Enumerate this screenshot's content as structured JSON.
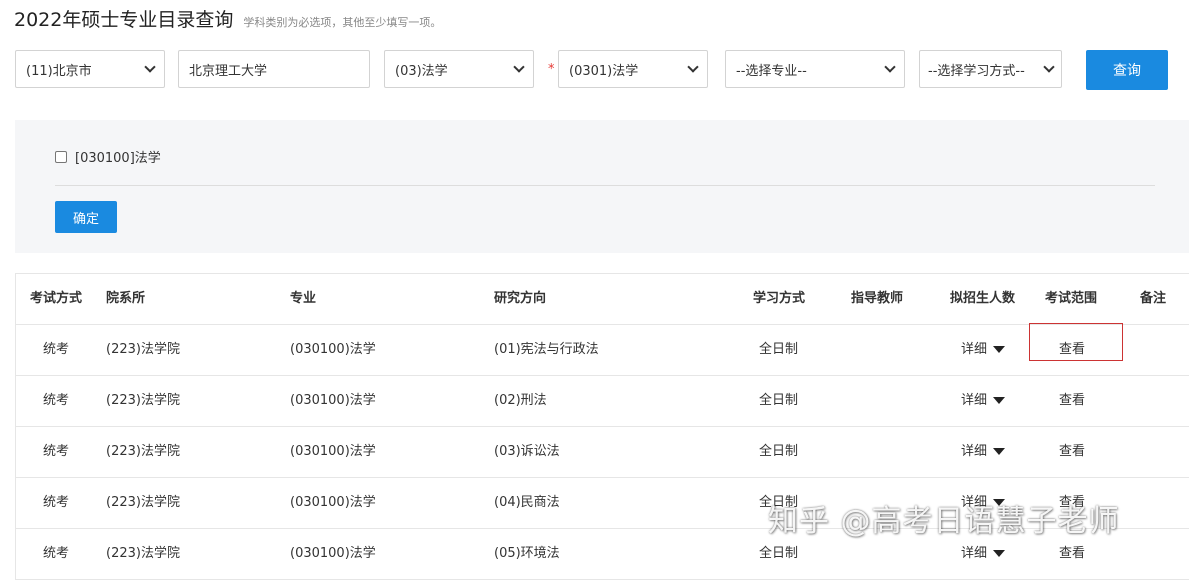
{
  "header": {
    "title": "2022年硕士专业目录查询",
    "hint": "学科类别为必选项，其他至少填写一项。"
  },
  "filters": {
    "province": "(11)北京市",
    "school": "北京理工大学",
    "category": "(03)法学",
    "required_mark": "*",
    "discipline": "(0301)法学",
    "major": "--选择专业--",
    "study_mode": "--选择学习方式--",
    "query_label": "查询"
  },
  "panel": {
    "checkbox_label": "[030100]法学",
    "confirm_label": "确定"
  },
  "table": {
    "columns": [
      "考试方式",
      "院系所",
      "专业",
      "研究方向",
      "学习方式",
      "指导教师",
      "拟招生人数",
      "考试范围",
      "备注"
    ],
    "rows": [
      {
        "exam": "统考",
        "dept": "(223)法学院",
        "major": "(030100)法学",
        "direction": "(01)宪法与行政法",
        "mode": "全日制",
        "advisor": "",
        "enroll": "详细",
        "scope": "查看",
        "note": ""
      },
      {
        "exam": "统考",
        "dept": "(223)法学院",
        "major": "(030100)法学",
        "direction": "(02)刑法",
        "mode": "全日制",
        "advisor": "",
        "enroll": "详细",
        "scope": "查看",
        "note": ""
      },
      {
        "exam": "统考",
        "dept": "(223)法学院",
        "major": "(030100)法学",
        "direction": "(03)诉讼法",
        "mode": "全日制",
        "advisor": "",
        "enroll": "详细",
        "scope": "查看",
        "note": ""
      },
      {
        "exam": "统考",
        "dept": "(223)法学院",
        "major": "(030100)法学",
        "direction": "(04)民商法",
        "mode": "全日制",
        "advisor": "",
        "enroll": "详细",
        "scope": "查看",
        "note": ""
      },
      {
        "exam": "统考",
        "dept": "(223)法学院",
        "major": "(030100)法学",
        "direction": "(05)环境法",
        "mode": "全日制",
        "advisor": "",
        "enroll": "详细",
        "scope": "查看",
        "note": ""
      }
    ]
  },
  "watermark": "知乎 @高考日语慧子老师",
  "colors": {
    "accent": "#1a8ae0",
    "highlight": "#cc3333",
    "panel_bg": "#f5f6f8"
  }
}
